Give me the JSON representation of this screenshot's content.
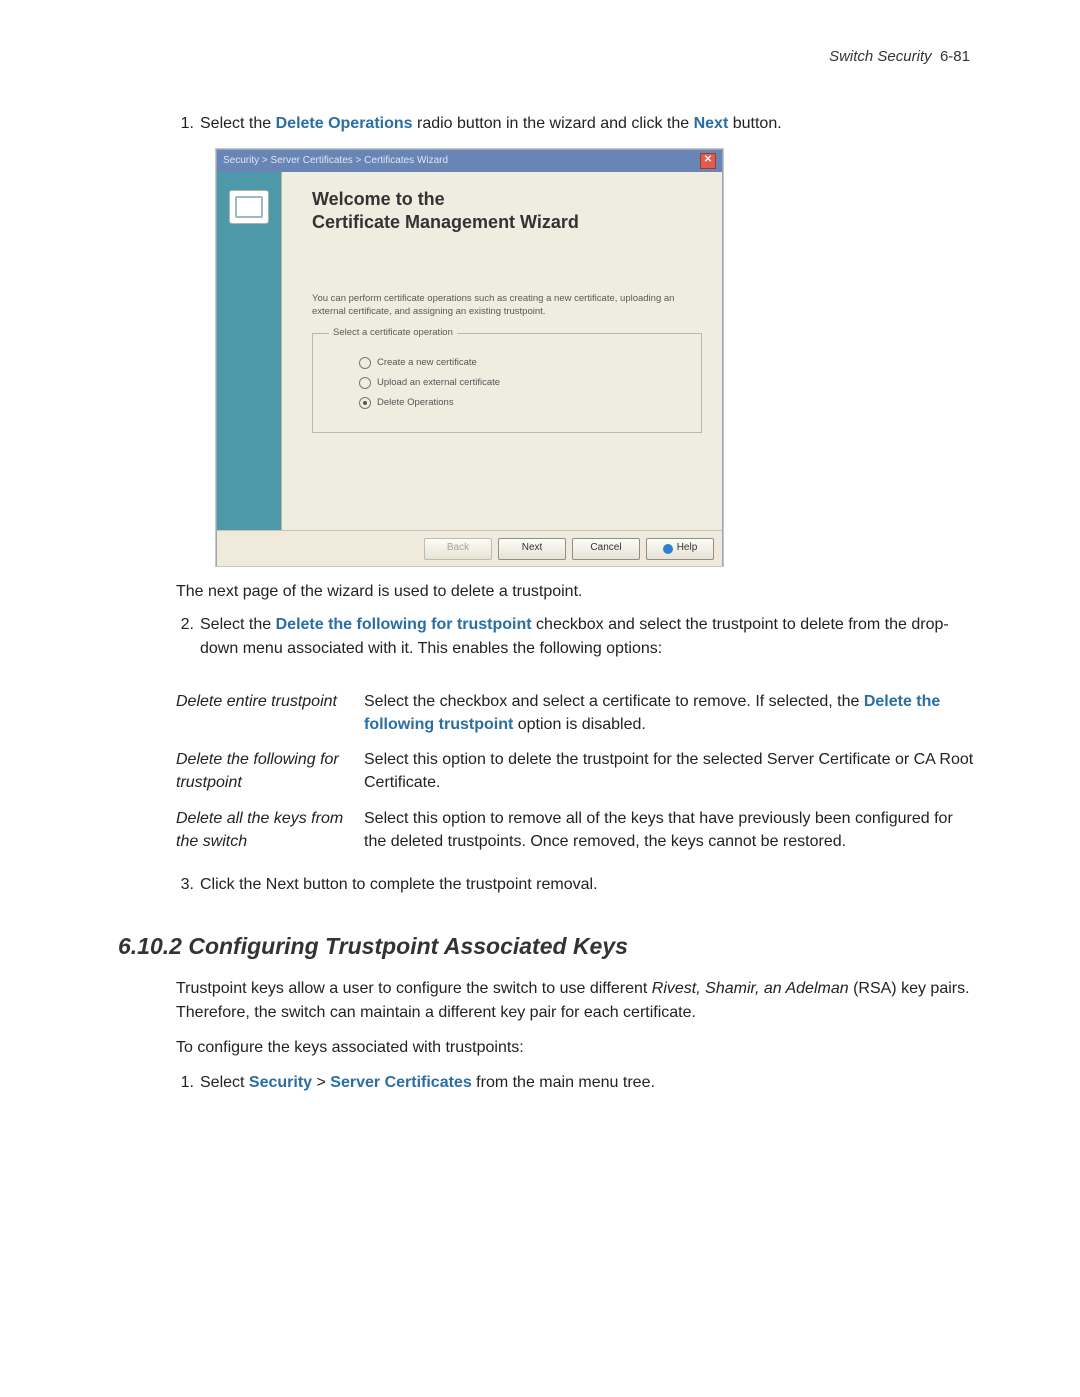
{
  "header": {
    "chapter": "Switch Security",
    "page": "6-81"
  },
  "steps": {
    "s1": {
      "num": "1.",
      "pre": "Select the ",
      "strong1": "Delete Operations",
      "mid": " radio button in the wizard and click the ",
      "strong2": "Next",
      "post": " button."
    },
    "after_wizard": "The next page of the wizard is used to delete a trustpoint.",
    "s2": {
      "num": "2.",
      "pre": "Select the ",
      "strong": "Delete the following for trustpoint",
      "post": " checkbox and select the trustpoint to delete from the drop-down menu associated with it. This enables the following options:"
    },
    "s3": {
      "num": "3.",
      "text": "Click the Next button to complete the trustpoint removal."
    }
  },
  "wizard": {
    "breadcrumb": "Security > Server Certificates > Certificates Wizard",
    "heading_l1": "Welcome to the",
    "heading_l2": "Certificate Management Wizard",
    "desc": "You can perform certificate operations such as creating a new certificate, uploading an external certificate, and assigning an existing trustpoint.",
    "fieldset_label": "Select a certificate operation",
    "options": {
      "create": "Create a new certificate",
      "upload": "Upload an external certificate",
      "delete": "Delete Operations"
    },
    "buttons": {
      "back": "Back",
      "next": "Next",
      "cancel": "Cancel",
      "help": "Help"
    },
    "close": "✕"
  },
  "options_table": {
    "r1": {
      "label": "Delete entire trustpoint",
      "desc_pre": "Select the checkbox and select a certificate to remove. If selected, the ",
      "desc_strong": "Delete the following trustpoint",
      "desc_post": " option is disabled."
    },
    "r2": {
      "label": "Delete the following for trustpoint",
      "desc": "Select this option to delete the trustpoint for the selected Server Certificate or CA Root Certificate."
    },
    "r3": {
      "label": "Delete all the keys from the switch",
      "desc": "Select this option to remove all of the keys that have previously been configured for the deleted trustpoints. Once removed, the keys cannot be restored."
    }
  },
  "section2": {
    "heading": "6.10.2 Configuring Trustpoint Associated Keys",
    "p1_pre": "Trustpoint keys allow a user to configure the switch to use different ",
    "p1_em": "Rivest, Shamir, an Adelman",
    "p1_post": " (RSA) key pairs. Therefore, the switch can maintain a different key pair for each certificate.",
    "p2": "To configure the keys associated with trustpoints:",
    "step1": {
      "num": "1.",
      "pre": "Select ",
      "s1": "Security",
      "gt": " > ",
      "s2": "Server Certificates",
      "post": " from the main menu tree."
    }
  }
}
